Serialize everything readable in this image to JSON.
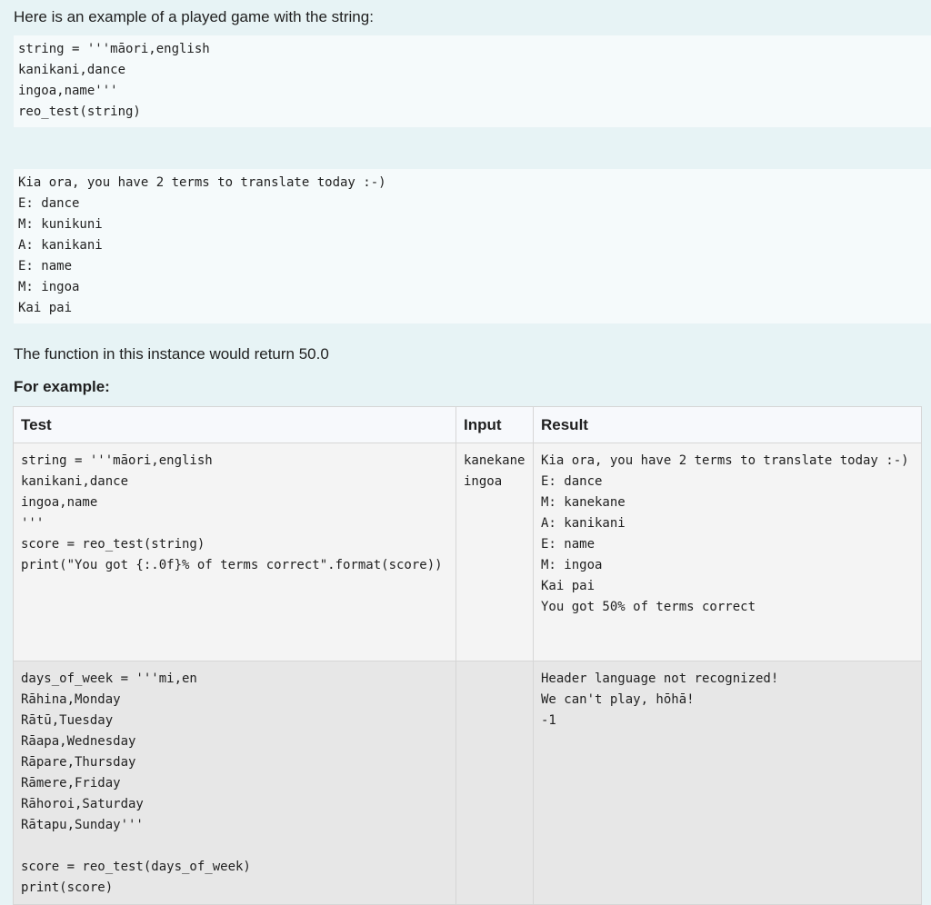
{
  "intro_text": "Here is an example of a played game with the string:",
  "code_block_1": "string = '''māori,english\nkanikani,dance\ningoa,name'''\nreo_test(string)",
  "code_block_2": "Kia ora, you have 2 terms to translate today :-)\nE: dance\nM: kunikuni\nA: kanikani\nE: name\nM: ingoa\nKai pai",
  "return_text": "The function in this instance would return 50.0",
  "example_heading": "For example:",
  "table": {
    "headers": {
      "test": "Test",
      "input": "Input",
      "result": "Result"
    },
    "rows": [
      {
        "test": "string = '''māori,english\nkanikani,dance\ningoa,name\n'''\nscore = reo_test(string)\nprint(\"You got {:.0f}% of terms correct\".format(score))",
        "input": "kanekane\ningoa",
        "result": "Kia ora, you have 2 terms to translate today :-)\nE: dance\nM: kanekane\nA: kanikani\nE: name\nM: ingoa\nKai pai\nYou got 50% of terms correct"
      },
      {
        "test": "days_of_week = '''mi,en\nRāhina,Monday\nRātū,Tuesday\nRāapa,Wednesday\nRāpare,Thursday\nRāmere,Friday\nRāhoroi,Saturday\nRātapu,Sunday'''\n\nscore = reo_test(days_of_week)\nprint(score)",
        "input": "",
        "result": "Header language not recognized!\nWe can't play, hōhā!\n-1"
      }
    ]
  }
}
